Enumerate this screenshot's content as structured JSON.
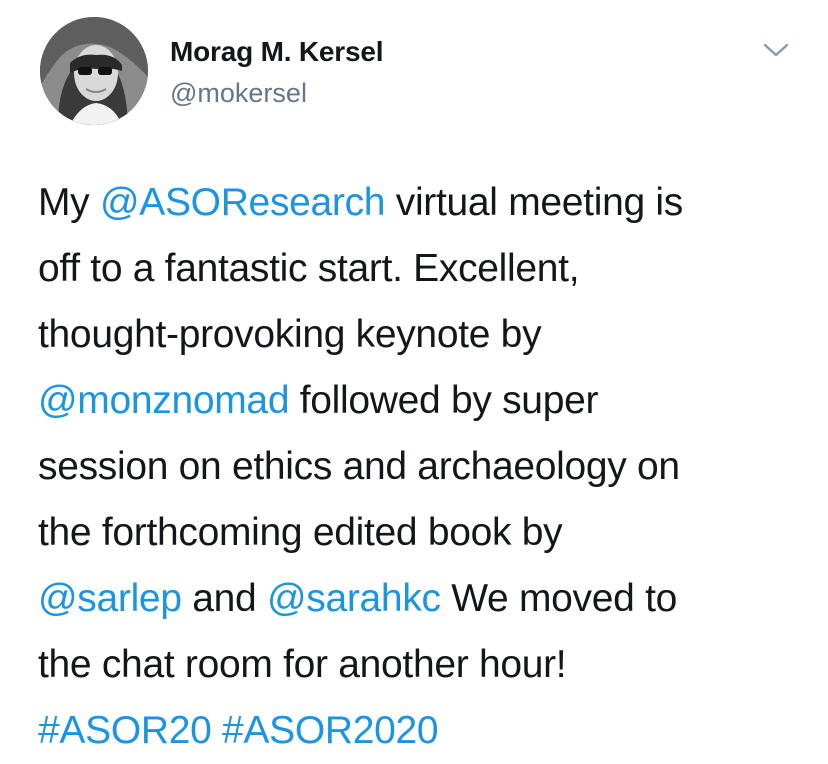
{
  "author": {
    "display_name": "Morag M. Kersel",
    "handle": "@mokersel"
  },
  "menu_icon": "chevron-down-icon",
  "colors": {
    "link": "#1b95e0",
    "text": "#14171a",
    "secondary": "#657786"
  },
  "tweet": {
    "lines": [
      [
        {
          "t": "My ",
          "link": false
        },
        {
          "t": "@ASOResearch",
          "link": true
        },
        {
          "t": " virtual meeting is",
          "link": false
        }
      ],
      [
        {
          "t": "off to a fantastic start. Excellent,",
          "link": false
        }
      ],
      [
        {
          "t": "thought-provoking keynote by",
          "link": false
        }
      ],
      [
        {
          "t": "@monznomad",
          "link": true
        },
        {
          "t": " followed by super",
          "link": false
        }
      ],
      [
        {
          "t": "session on ethics and archaeology on",
          "link": false
        }
      ],
      [
        {
          "t": "the forthcoming edited book by",
          "link": false
        }
      ],
      [
        {
          "t": "@sarlep",
          "link": true
        },
        {
          "t": " and ",
          "link": false
        },
        {
          "t": "@sarahkc",
          "link": true
        },
        {
          "t": " We moved to",
          "link": false
        }
      ],
      [
        {
          "t": "the chat room for another hour!",
          "link": false
        }
      ],
      [
        {
          "t": "#ASOR20",
          "link": true
        },
        {
          "t": " ",
          "link": false
        },
        {
          "t": "#ASOR2020",
          "link": true
        }
      ]
    ]
  }
}
